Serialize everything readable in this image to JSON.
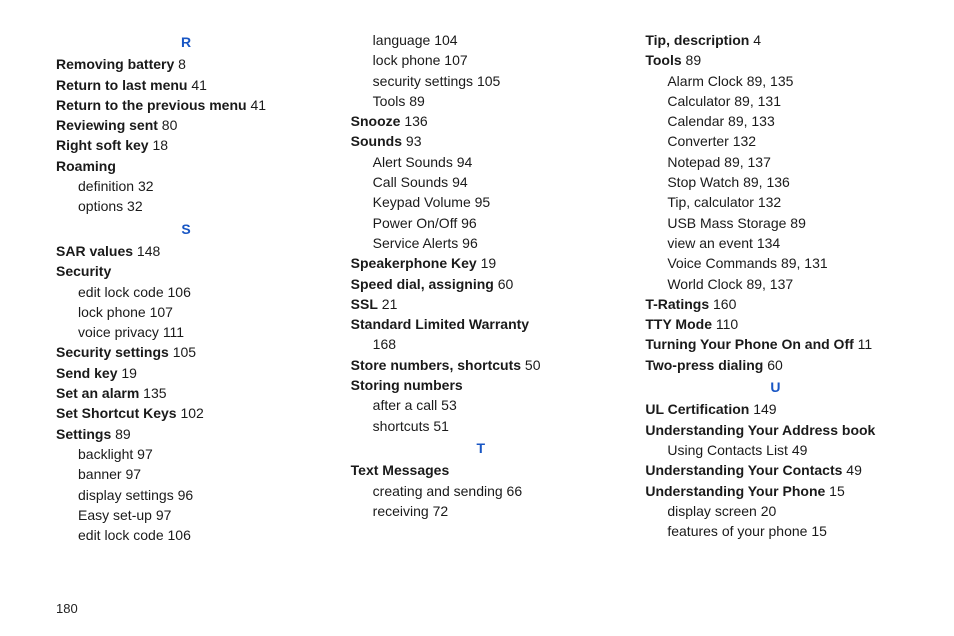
{
  "pageNumber": "180",
  "columns": [
    [
      {
        "type": "letter",
        "text": "R"
      },
      {
        "type": "entry",
        "bold": "Removing battery",
        "pg": " 8"
      },
      {
        "type": "entry",
        "bold": "Return to last menu",
        "pg": " 41"
      },
      {
        "type": "entry",
        "bold": "Return to the previous menu",
        "pg": " 41"
      },
      {
        "type": "entry",
        "bold": "Reviewing sent",
        "pg": " 80"
      },
      {
        "type": "entry",
        "bold": "Right soft key",
        "pg": " 18"
      },
      {
        "type": "entry",
        "bold": "Roaming",
        "pg": ""
      },
      {
        "type": "sub",
        "text": "definition ",
        "pg": "32"
      },
      {
        "type": "sub",
        "text": "options ",
        "pg": "32"
      },
      {
        "type": "letter",
        "text": "S"
      },
      {
        "type": "entry",
        "bold": "SAR values",
        "pg": " 148"
      },
      {
        "type": "entry",
        "bold": "Security",
        "pg": ""
      },
      {
        "type": "sub",
        "text": "edit lock code ",
        "pg": "106"
      },
      {
        "type": "sub",
        "text": "lock phone ",
        "pg": "107"
      },
      {
        "type": "sub",
        "text": "voice privacy ",
        "pg": "111"
      },
      {
        "type": "entry",
        "bold": "Security settings",
        "pg": " 105"
      },
      {
        "type": "entry",
        "bold": "Send key",
        "pg": " 19"
      },
      {
        "type": "entry",
        "bold": "Set an alarm",
        "pg": " 135"
      },
      {
        "type": "entry",
        "bold": "Set Shortcut Keys",
        "pg": " 102"
      },
      {
        "type": "entry",
        "bold": "Settings",
        "pg": " 89"
      },
      {
        "type": "sub",
        "text": "backlight ",
        "pg": "97"
      },
      {
        "type": "sub",
        "text": "banner ",
        "pg": "97"
      },
      {
        "type": "sub",
        "text": "display settings ",
        "pg": "96"
      },
      {
        "type": "sub",
        "text": "Easy set-up ",
        "pg": "97"
      },
      {
        "type": "sub",
        "text": "edit lock code ",
        "pg": "106"
      }
    ],
    [
      {
        "type": "sub",
        "text": "language ",
        "pg": "104"
      },
      {
        "type": "sub",
        "text": "lock phone ",
        "pg": "107"
      },
      {
        "type": "sub",
        "text": "security settings ",
        "pg": "105"
      },
      {
        "type": "sub",
        "text": "Tools ",
        "pg": "89"
      },
      {
        "type": "entry",
        "bold": "Snooze",
        "pg": " 136"
      },
      {
        "type": "entry",
        "bold": "Sounds",
        "pg": " 93"
      },
      {
        "type": "sub",
        "text": "Alert Sounds ",
        "pg": "94"
      },
      {
        "type": "sub",
        "text": "Call Sounds ",
        "pg": "94"
      },
      {
        "type": "sub",
        "text": "Keypad Volume ",
        "pg": "95"
      },
      {
        "type": "sub",
        "text": "Power On/Off ",
        "pg": "96"
      },
      {
        "type": "sub",
        "text": "Service Alerts ",
        "pg": "96"
      },
      {
        "type": "entry",
        "bold": "Speakerphone Key",
        "pg": " 19"
      },
      {
        "type": "entry",
        "bold": "Speed dial, assigning",
        "pg": " 60"
      },
      {
        "type": "entry",
        "bold": "SSL",
        "pg": " 21"
      },
      {
        "type": "entry",
        "bold": "Standard Limited Warranty",
        "pg": ""
      },
      {
        "type": "sub",
        "text": "",
        "pg": "168"
      },
      {
        "type": "entry",
        "bold": "Store numbers, shortcuts",
        "pg": " 50"
      },
      {
        "type": "entry",
        "bold": "Storing numbers",
        "pg": ""
      },
      {
        "type": "sub",
        "text": "after a call ",
        "pg": "53"
      },
      {
        "type": "sub",
        "text": "shortcuts ",
        "pg": "51"
      },
      {
        "type": "letter",
        "text": "T"
      },
      {
        "type": "entry",
        "bold": "Text Messages",
        "pg": ""
      },
      {
        "type": "sub",
        "text": "creating and sending ",
        "pg": "66"
      },
      {
        "type": "sub",
        "text": "receiving ",
        "pg": "72"
      }
    ],
    [
      {
        "type": "entry",
        "bold": "Tip, description",
        "pg": " 4"
      },
      {
        "type": "entry",
        "bold": "Tools",
        "pg": " 89"
      },
      {
        "type": "sub",
        "text": "Alarm Clock ",
        "pg": "89, 135"
      },
      {
        "type": "sub",
        "text": "Calculator ",
        "pg": "89, 131"
      },
      {
        "type": "sub",
        "text": "Calendar ",
        "pg": "89, 133"
      },
      {
        "type": "sub",
        "text": "Converter ",
        "pg": "132"
      },
      {
        "type": "sub",
        "text": "Notepad ",
        "pg": "89, 137"
      },
      {
        "type": "sub",
        "text": "Stop Watch ",
        "pg": "89, 136"
      },
      {
        "type": "sub",
        "text": "Tip, calculator ",
        "pg": "132"
      },
      {
        "type": "sub",
        "text": "USB Mass Storage ",
        "pg": "89"
      },
      {
        "type": "sub",
        "text": "view an event ",
        "pg": "134"
      },
      {
        "type": "sub",
        "text": "Voice Commands ",
        "pg": "89, 131"
      },
      {
        "type": "sub",
        "text": "World Clock ",
        "pg": "89, 137"
      },
      {
        "type": "entry",
        "bold": "T-Ratings",
        "pg": " 160"
      },
      {
        "type": "entry",
        "bold": "TTY Mode",
        "pg": " 110"
      },
      {
        "type": "entry",
        "bold": "Turning Your Phone On and Off",
        "pg": " 11"
      },
      {
        "type": "entry",
        "bold": "Two-press dialing",
        "pg": " 60"
      },
      {
        "type": "letter",
        "text": "U"
      },
      {
        "type": "entry",
        "bold": "UL Certification",
        "pg": " 149"
      },
      {
        "type": "entry",
        "bold": "Understanding Your Address book",
        "pg": ""
      },
      {
        "type": "sub",
        "text": "Using Contacts List ",
        "pg": "49"
      },
      {
        "type": "entry",
        "bold": "Understanding Your Contacts",
        "pg": " 49"
      },
      {
        "type": "entry",
        "bold": "Understanding Your Phone",
        "pg": " 15"
      },
      {
        "type": "sub",
        "text": "display screen ",
        "pg": "20"
      },
      {
        "type": "sub",
        "text": "features of your phone ",
        "pg": "15"
      }
    ]
  ]
}
